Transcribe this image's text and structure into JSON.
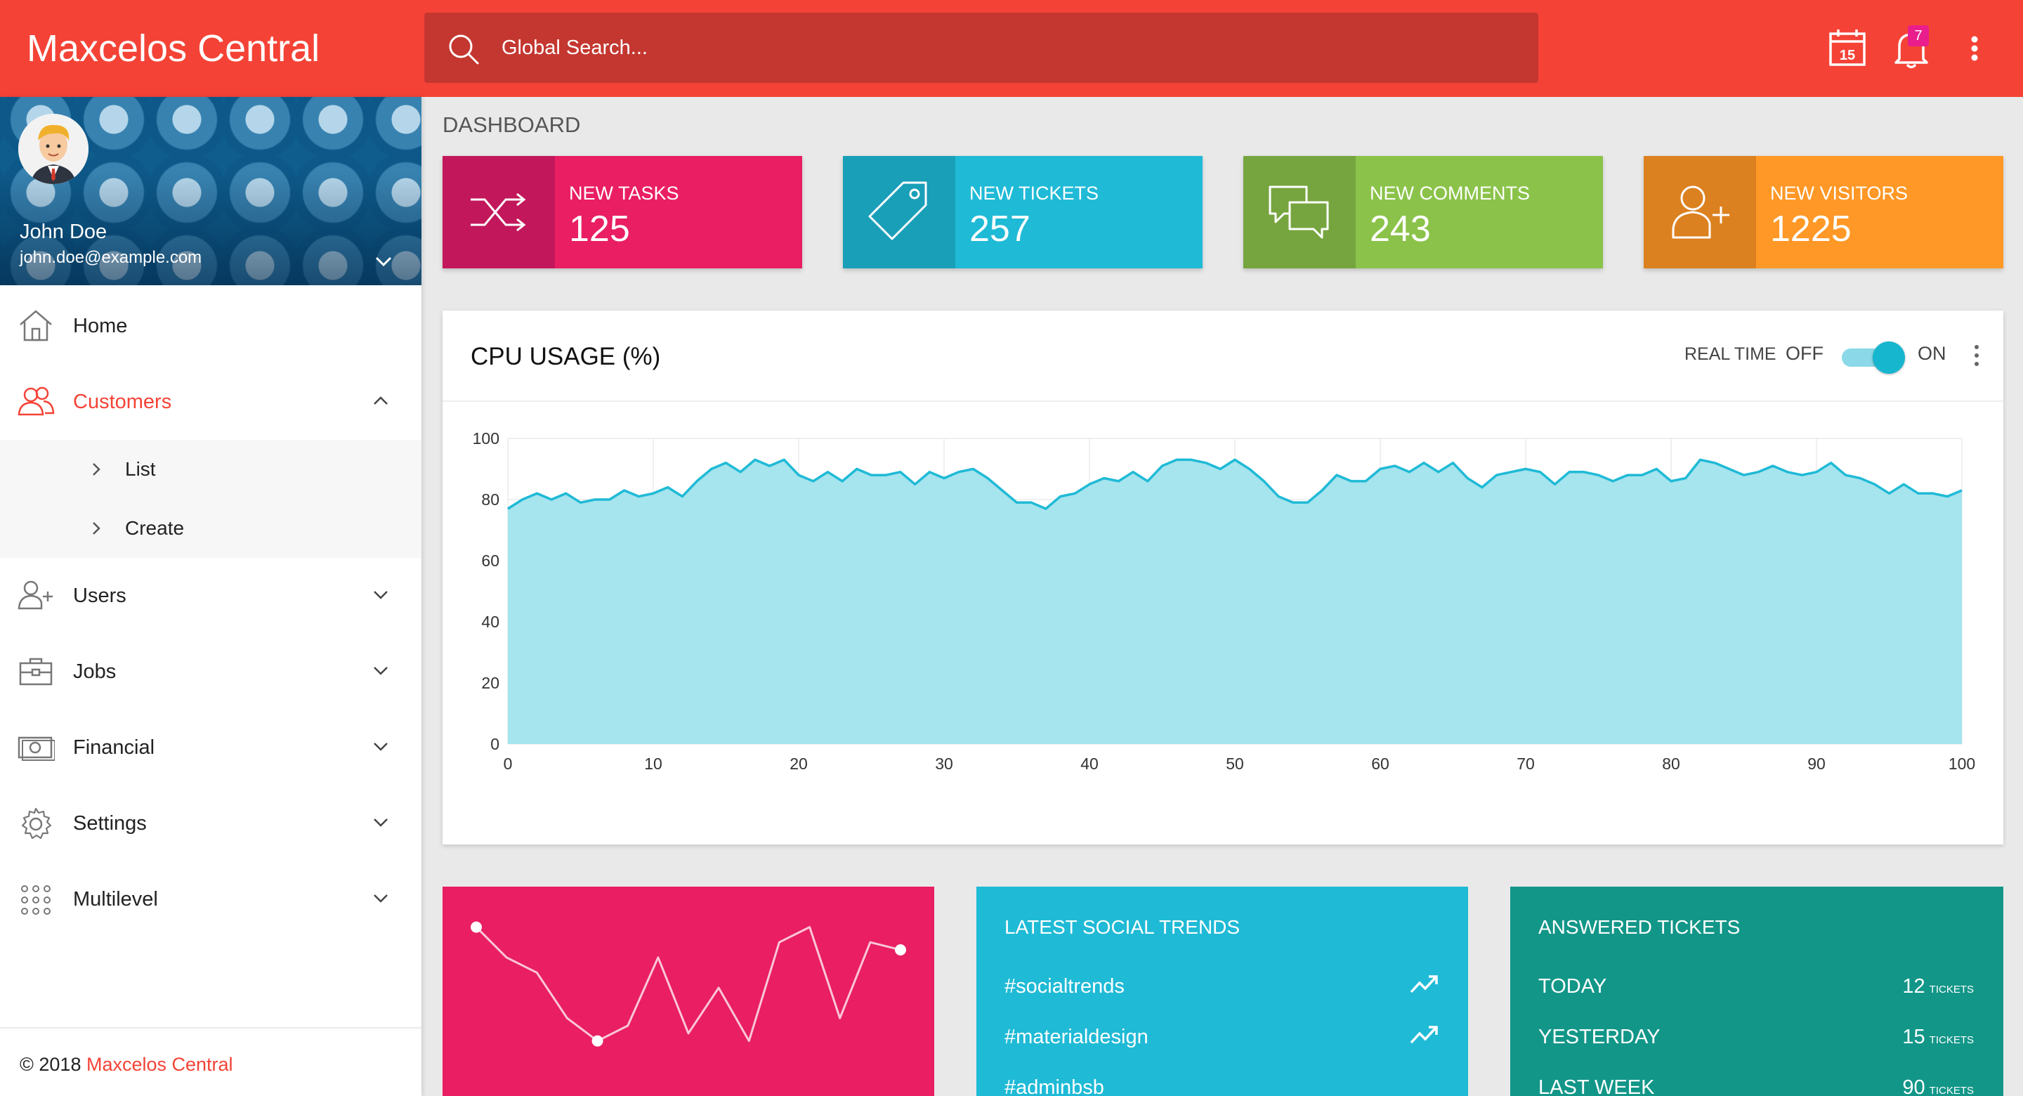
{
  "app": {
    "title": "Maxcelos Central",
    "accent_color": "#f44336"
  },
  "search": {
    "placeholder": "Global Search..."
  },
  "header": {
    "calendar_day": "15",
    "notification_count": "7"
  },
  "user": {
    "name": "John Doe",
    "email": "john.doe@example.com"
  },
  "sidebar": {
    "items": [
      {
        "label": "Home",
        "icon": "home-icon"
      },
      {
        "label": "Customers",
        "icon": "customers-icon",
        "expanded": true,
        "children": [
          {
            "label": "List"
          },
          {
            "label": "Create"
          }
        ]
      },
      {
        "label": "Users",
        "icon": "user-add-icon"
      },
      {
        "label": "Jobs",
        "icon": "briefcase-icon"
      },
      {
        "label": "Financial",
        "icon": "money-icon"
      },
      {
        "label": "Settings",
        "icon": "gear-icon"
      },
      {
        "label": "Multilevel",
        "icon": "grid-dots-icon"
      }
    ],
    "footer": {
      "copyright": "© 2018 ",
      "link": "Maxcelos Central"
    }
  },
  "page": {
    "title": "DASHBOARD"
  },
  "info_boxes": [
    {
      "label": "NEW TASKS",
      "value": "125",
      "icon": "shuffle-icon",
      "color": "#e91e63",
      "icon_bg": "#c2185b"
    },
    {
      "label": "NEW TICKETS",
      "value": "257",
      "icon": "tag-icon",
      "color": "#1fbad6",
      "icon_bg": "#1a9fb8"
    },
    {
      "label": "NEW COMMENTS",
      "value": "243",
      "icon": "chat-bubbles-icon",
      "color": "#8bc34a",
      "icon_bg": "#76a53f"
    },
    {
      "label": "NEW VISITORS",
      "value": "1225",
      "icon": "user-add-icon",
      "color": "#ff9826",
      "icon_bg": "#dc8120"
    }
  ],
  "cpu_card": {
    "title": "CPU USAGE (%)",
    "realtime_label": "REAL TIME",
    "off_label": "OFF",
    "on_label": "ON",
    "realtime_on": true
  },
  "chart_data": [
    {
      "type": "area",
      "title": "CPU USAGE (%)",
      "xlim": [
        0,
        100
      ],
      "ylim": [
        0,
        100
      ],
      "xticks": [
        0,
        10,
        20,
        30,
        40,
        50,
        60,
        70,
        80,
        90,
        100
      ],
      "yticks": [
        0,
        20,
        40,
        60,
        80,
        100
      ],
      "grid": true,
      "fill_color": "#a6e4ee",
      "line_color": "#1fbad6",
      "x": [
        0,
        1,
        2,
        3,
        4,
        5,
        6,
        7,
        8,
        9,
        10,
        11,
        12,
        13,
        14,
        15,
        16,
        17,
        18,
        19,
        20,
        21,
        22,
        23,
        24,
        25,
        26,
        27,
        28,
        29,
        30,
        31,
        32,
        33,
        34,
        35,
        36,
        37,
        38,
        39,
        40,
        41,
        42,
        43,
        44,
        45,
        46,
        47,
        48,
        49,
        50,
        51,
        52,
        53,
        54,
        55,
        56,
        57,
        58,
        59,
        60,
        61,
        62,
        63,
        64,
        65,
        66,
        67,
        68,
        69,
        70,
        71,
        72,
        73,
        74,
        75,
        76,
        77,
        78,
        79,
        80,
        81,
        82,
        83,
        84,
        85,
        86,
        87,
        88,
        89,
        90,
        91,
        92,
        93,
        94,
        95,
        96,
        97,
        98,
        99,
        100
      ],
      "y": [
        77,
        80,
        82,
        80,
        82,
        79,
        80,
        80,
        83,
        81,
        82,
        84,
        81,
        86,
        90,
        92,
        89,
        93,
        91,
        93,
        88,
        86,
        89,
        86,
        90,
        88,
        88,
        89,
        85,
        89,
        87,
        89,
        90,
        87,
        83,
        79,
        79,
        77,
        81,
        82,
        85,
        87,
        86,
        89,
        86,
        91,
        93,
        93,
        92,
        90,
        93,
        90,
        86,
        81,
        79,
        79,
        83,
        88,
        86,
        86,
        90,
        91,
        89,
        92,
        89,
        92,
        87,
        84,
        88,
        89,
        90,
        89,
        85,
        89,
        89,
        88,
        86,
        88,
        88,
        90,
        86,
        87,
        93,
        92,
        90,
        88,
        89,
        91,
        89,
        88,
        89,
        92,
        88,
        87,
        85,
        82,
        85,
        82,
        82,
        81,
        83
      ]
    },
    {
      "type": "line",
      "x": [
        0,
        1,
        2,
        3,
        4,
        5,
        6,
        7,
        8,
        9,
        10,
        11,
        12,
        13,
        14
      ],
      "y": [
        9,
        7,
        6,
        3,
        1.5,
        2.5,
        7,
        2,
        5,
        1.5,
        8,
        9,
        3,
        8,
        7.5
      ],
      "line_color": "#ffffff"
    }
  ],
  "social_trends": {
    "title": "LATEST SOCIAL TRENDS",
    "items": [
      "#socialtrends",
      "#materialdesign",
      "#adminbsb"
    ]
  },
  "answered_tickets": {
    "title": "ANSWERED TICKETS",
    "unit": "TICKETS",
    "rows": [
      {
        "label": "TODAY",
        "count": "12"
      },
      {
        "label": "YESTERDAY",
        "count": "15"
      },
      {
        "label": "LAST WEEK",
        "count": "90"
      }
    ]
  }
}
